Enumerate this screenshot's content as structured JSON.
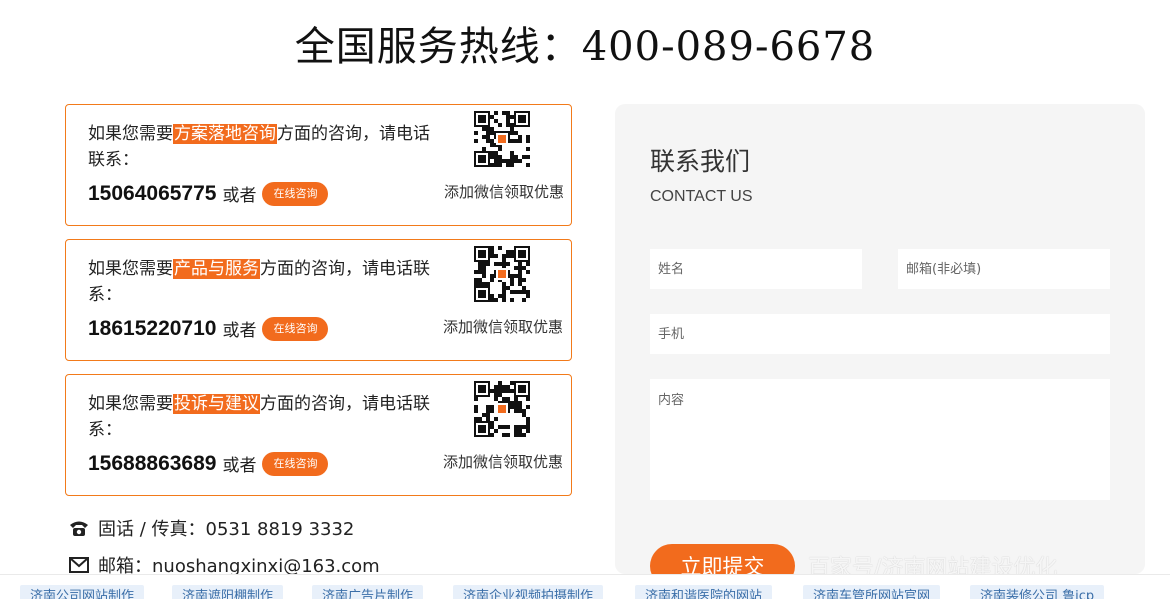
{
  "hotline": "全国服务热线：400-089-6678",
  "cards": [
    {
      "prefix": "如果您需要",
      "topic": "方案落地咨询",
      "suffix": "方面的咨询，请电话联系：",
      "phone": "15064065775",
      "or_text": "或者",
      "consult_label": "在线咨询",
      "qr_caption": "添加微信领取优惠"
    },
    {
      "prefix": "如果您需要",
      "topic": "产品与服务",
      "suffix": "方面的咨询，请电话联系：",
      "phone": "18615220710",
      "or_text": "或者",
      "consult_label": "在线咨询",
      "qr_caption": "添加微信领取优惠"
    },
    {
      "prefix": "如果您需要",
      "topic": "投诉与建议",
      "suffix": "方面的咨询，请电话联系：",
      "phone": "15688863689",
      "or_text": "或者",
      "consult_label": "在线咨询",
      "qr_caption": "添加微信领取优惠"
    }
  ],
  "contact": {
    "tel_label": "固话 / 传真：0531 8819 3332",
    "email_label": "邮箱：nuoshangxinxi@163.com",
    "tel_icon": "telephone-icon",
    "email_icon": "envelope-icon"
  },
  "form": {
    "title": "联系我们",
    "subtitle": "CONTACT US",
    "name_placeholder": "姓名",
    "email_placeholder": "邮箱(非必填)",
    "mobile_placeholder": "手机",
    "content_placeholder": "内容",
    "submit_label": "立即提交"
  },
  "watermark": "百家号/济南网站建设优化",
  "tags": [
    "济南公司网站制作",
    "济南遮阳棚制作",
    "济南广告片制作",
    "济南企业视频拍摄制作",
    "济南和谐医院的网站",
    "济南车管所网站官网",
    "济南装修公司 鲁icp"
  ],
  "colors": {
    "accent": "#f26b1d",
    "panel_bg": "#f5f5f5",
    "tag_bg": "#e8f0fa",
    "tag_text": "#3a6ea8"
  }
}
